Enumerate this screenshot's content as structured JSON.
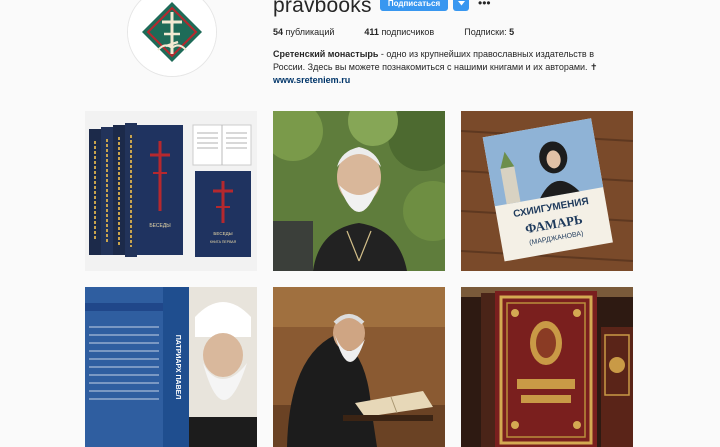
{
  "profile": {
    "username": "pravbooks",
    "subscribe_label": "Подписаться",
    "avatar_icon": "monastery-cross-logo-icon",
    "more_icon": "more-options-icon"
  },
  "stats": {
    "posts_count": "54",
    "posts_label": "публикаций",
    "followers_count": "411",
    "followers_label": "подписчиков",
    "following_label": "Подписки:",
    "following_count": "5"
  },
  "bio": {
    "name": "Сретенский монастырь",
    "text": " - одно из крупнейших православных издательств в России. Здесь вы можете познакомиться с нашими книгами и их авторами. ✝",
    "link": "www.sreteniem.ru"
  },
  "colors": {
    "accent": "#3897f0",
    "logo_green": "#1e6b58",
    "logo_red": "#b5282e"
  },
  "posts": [
    {
      "name": "book-set-volumes",
      "cover_title": "БЕСЕДЫ ПРЕПОДОБНОГО СИМЕОНА НОВОГО БОГОСЛОВА",
      "cover_subtitle": "КНИГА ПЕРВАЯ"
    },
    {
      "name": "elder-portrait"
    },
    {
      "name": "book-fomar",
      "cover_line1": "СХИИГУМЕНИЯ",
      "cover_line2": "ФАМАРЬ",
      "cover_line3": "(МАРДЖАНОВА)"
    },
    {
      "name": "book-patriarch-pavel",
      "cover_line1": "ПАТРИАРХ",
      "cover_line2": "ПАВЕЛ"
    },
    {
      "name": "elder-reading"
    },
    {
      "name": "book-ornate-gold"
    }
  ]
}
